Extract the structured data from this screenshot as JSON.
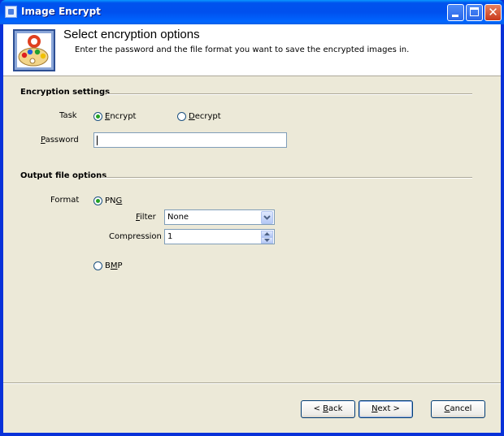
{
  "window": {
    "title": "Image Encrypt",
    "minimize_icon": "minimize-icon",
    "maximize_icon": "maximize-icon",
    "close_icon": "close-icon",
    "close_glyph": "✕"
  },
  "header": {
    "title": "Select encryption options",
    "subtitle": "Enter the password and the file format you want to save the encrypted images in.",
    "icon": "paint-palette-icon"
  },
  "encryption": {
    "group_title": "Encryption settings",
    "task_label": "Task",
    "encrypt_first": "E",
    "encrypt_rest": "ncrypt",
    "encrypt_checked": true,
    "decrypt_first": "D",
    "decrypt_rest": "ecrypt",
    "decrypt_checked": false,
    "password_first": "P",
    "password_rest": "assword",
    "password_value": ""
  },
  "output": {
    "group_title": "Output file options",
    "format_label": "Format",
    "png_pre": "PN",
    "png_key": "G",
    "png_checked": true,
    "filter_first": "F",
    "filter_rest": "ilter",
    "filter_value": "None",
    "compression_label": "Compression",
    "compression_value": "1",
    "bmp_pre": "B",
    "bmp_key": "M",
    "bmp_post": "P",
    "bmp_checked": false
  },
  "buttons": {
    "back_pre": "< ",
    "back_key": "B",
    "back_post": "ack",
    "next_key": "N",
    "next_post": "ext >",
    "cancel_key": "C",
    "cancel_post": "ancel"
  },
  "colors": {
    "titlebar": "#0054e3",
    "face": "#ece9d8",
    "radio_dot": "#21a121"
  }
}
